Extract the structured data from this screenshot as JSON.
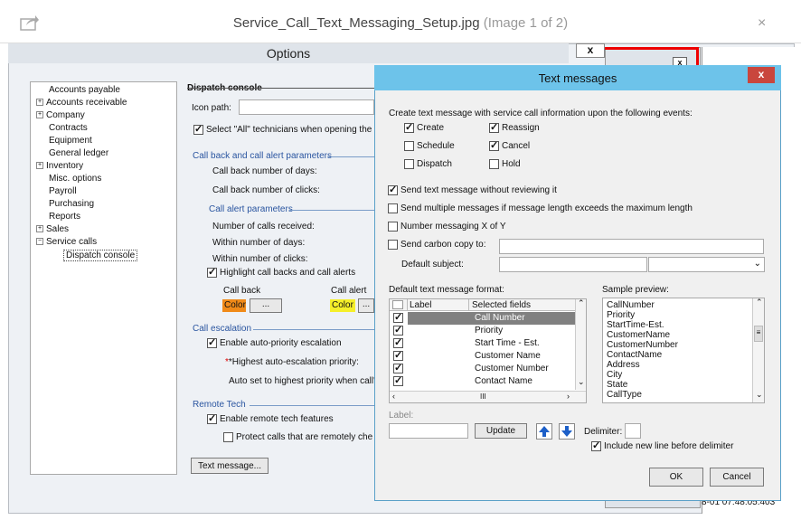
{
  "viewer": {
    "filename": "Service_Call_Text_Messaging_Setup.jpg",
    "counter": "(Image 1 of 2)",
    "close": "×"
  },
  "options": {
    "title": "Options",
    "close": "x",
    "tree": [
      "Accounts payable",
      "Accounts receivable",
      "Company",
      "Contracts",
      "Equipment",
      "General ledger",
      "Inventory",
      "Misc. options",
      "Payroll",
      "Purchasing",
      "Reports",
      "Sales",
      "Service calls",
      "Dispatch console"
    ],
    "section_title": "Dispatch console",
    "icon_path_label": "Icon path:",
    "select_all": "Select \"All\" technicians when opening the",
    "callback_group": "Call back and call alert parameters",
    "callback_days": "Call back number of days:",
    "callback_clicks": "Call back number of clicks:",
    "alert_group": "Call alert parameters",
    "calls_received": "Number of calls received:",
    "within_days": "Within number of days:",
    "within_clicks": "Within number of clicks:",
    "highlight": "Highlight call backs and call alerts",
    "call_back_label": "Call back",
    "call_alert_label": "Call alert",
    "color_label": "Color",
    "ellipsis": "...",
    "escalation_group": "Call escalation",
    "auto_priority": "Enable auto-priority escalation",
    "highest_priority": "*Highest auto-escalation priority:",
    "auto_set": "Auto set to highest priority when call's",
    "remote_group": "Remote Tech",
    "enable_remote": "Enable remote tech features",
    "protect_calls": "Protect calls that are remotely che",
    "text_message_btn": "Text message...",
    "bg_timestamp": "8-01 07:48:05.403"
  },
  "text_messages": {
    "title": "Text messages",
    "close": "x",
    "intro": "Create text message with service call information upon the following events:",
    "events": {
      "create": "Create",
      "reassign": "Reassign",
      "schedule": "Schedule",
      "cancel": "Cancel",
      "dispatch": "Dispatch",
      "hold": "Hold"
    },
    "send_without_review": "Send text message without reviewing it",
    "send_multiple": "Send multiple messages if message length exceeds the maximum length",
    "number_messaging": "Number messaging X of Y",
    "carbon_copy": "Send carbon copy to:",
    "default_subject": "Default subject:",
    "format_label": "Default text message format:",
    "col_label": "Label",
    "col_fields": "Selected fields",
    "fields": [
      "Call Number",
      "Priority",
      "Start Time - Est.",
      "Customer Name",
      "Customer Number",
      "Contact Name"
    ],
    "hscroll": "III",
    "sample_label": "Sample preview:",
    "sample": [
      "CallNumber",
      "Priority",
      "StartTime-Est.",
      "CustomerName",
      "CustomerNumber",
      "ContactName",
      "Address",
      "City",
      "State",
      "CallType"
    ],
    "label_label": "Label:",
    "update": "Update",
    "delimiter": "Delimiter:",
    "newline": "Include new line before delimiter",
    "ok": "OK",
    "cancel": "Cancel"
  }
}
